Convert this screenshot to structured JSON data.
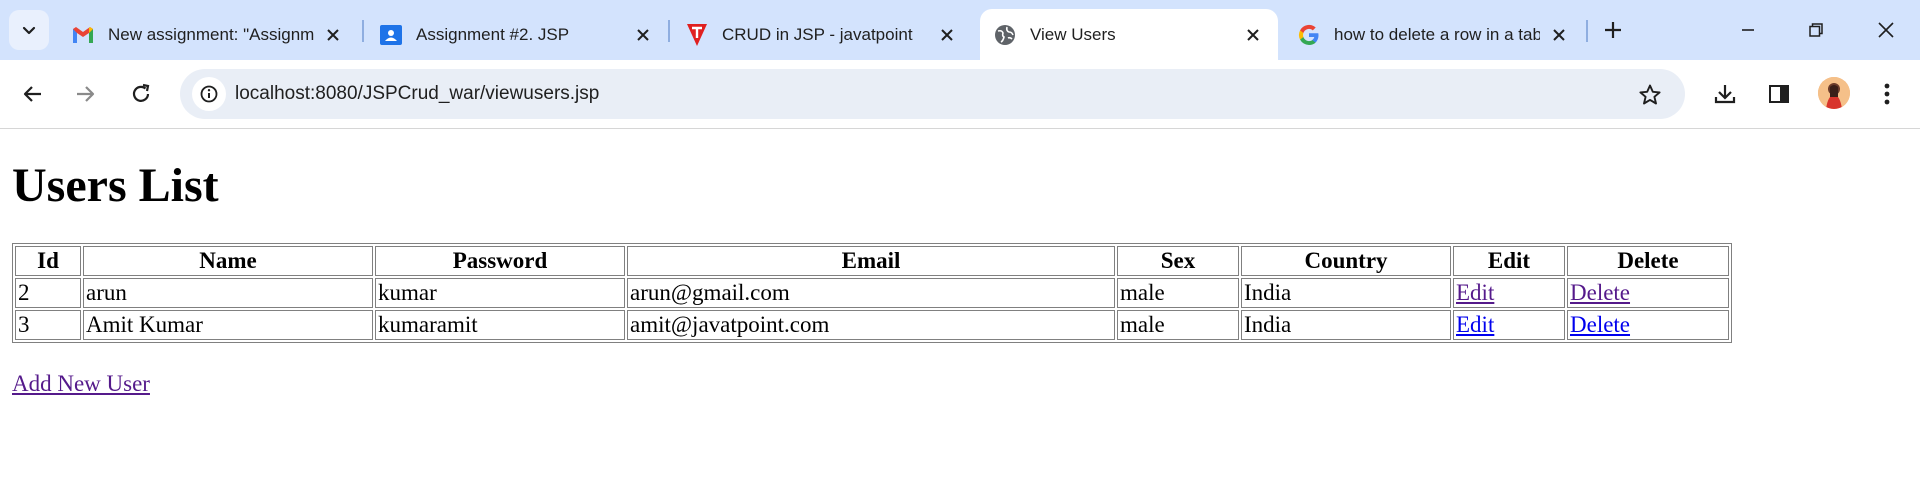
{
  "browser": {
    "tabs": [
      {
        "title": "New assignment: \"Assignment #2. JSP\"",
        "icon": "gmail-icon",
        "active": false
      },
      {
        "title": "Assignment #2. JSP",
        "icon": "classroom-icon",
        "active": false
      },
      {
        "title": "CRUD in JSP - javatpoint",
        "icon": "javatpoint-icon",
        "active": false
      },
      {
        "title": "View Users",
        "icon": "globe-icon",
        "active": true
      },
      {
        "title": "how to delete a row in a table",
        "icon": "google-icon",
        "active": false
      }
    ],
    "url": "localhost:8080/JSPCrud_war/viewusers.jsp",
    "accent_color": "#d3e3fd"
  },
  "page": {
    "heading": "Users List",
    "table": {
      "headers": [
        "Id",
        "Name",
        "Password",
        "Email",
        "Sex",
        "Country",
        "Edit",
        "Delete"
      ],
      "rows": [
        {
          "id": "2",
          "name": "arun",
          "password": "kumar",
          "email": "arun@gmail.com",
          "sex": "male",
          "country": "India",
          "edit": "Edit",
          "delete": "Delete"
        },
        {
          "id": "3",
          "name": "Amit Kumar",
          "password": "kumaramit",
          "email": "amit@javatpoint.com",
          "sex": "male",
          "country": "India",
          "edit": "Edit",
          "delete": "Delete"
        }
      ]
    },
    "add_link": "Add New User"
  }
}
